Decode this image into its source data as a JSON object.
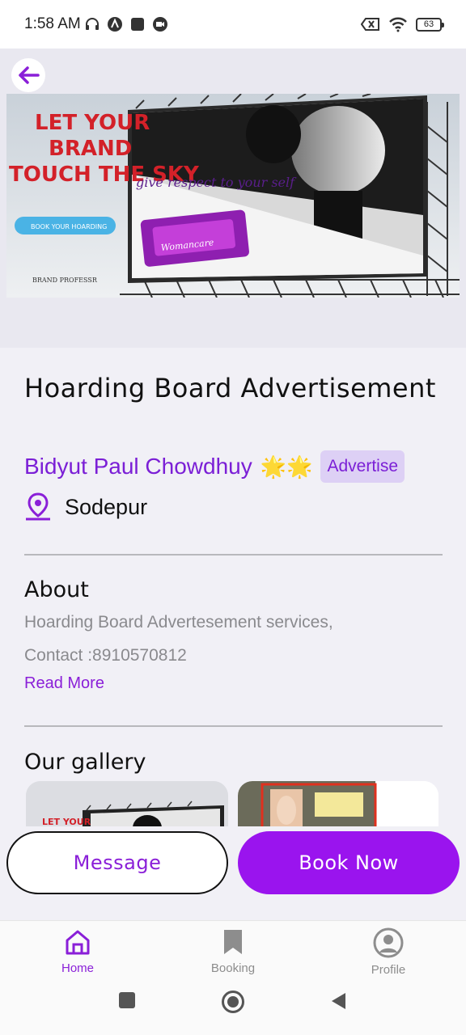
{
  "status_bar": {
    "time": "1:58 AM",
    "battery": "63"
  },
  "hero": {
    "banner_text": {
      "headline_1": "LET YOUR",
      "headline_2": "BRAND",
      "headline_3": "TOUCH THE SKY",
      "cta": "BOOK YOUR HOARDING",
      "brand": "BRAND PROFESSR",
      "tagline": "give respect to your self",
      "product": "Womancare"
    }
  },
  "listing": {
    "title": "Hoarding Board Advertisement",
    "owner": "Bidyut Paul Chowdhuy",
    "stars": "🌟🌟",
    "tag": "Advertise",
    "location": "Sodepur"
  },
  "about": {
    "heading": "About",
    "line1": "Hoarding Board Advertesement services,",
    "line2": "Contact :8910570812",
    "read_more": "Read More"
  },
  "gallery": {
    "heading": "Our gallery",
    "thumb1_text": "LET YOUR"
  },
  "actions": {
    "message": "Message",
    "book_now": "Book Now"
  },
  "bottom_nav": {
    "items": [
      {
        "label": "Home",
        "icon": "home-icon",
        "active": true
      },
      {
        "label": "Booking",
        "icon": "bookmark-icon",
        "active": false
      },
      {
        "label": "Profile",
        "icon": "profile-icon",
        "active": false
      }
    ]
  },
  "colors": {
    "accent": "#9a14ee",
    "accent_text": "#7b1fd6",
    "tag_bg": "#ddd0f5"
  }
}
